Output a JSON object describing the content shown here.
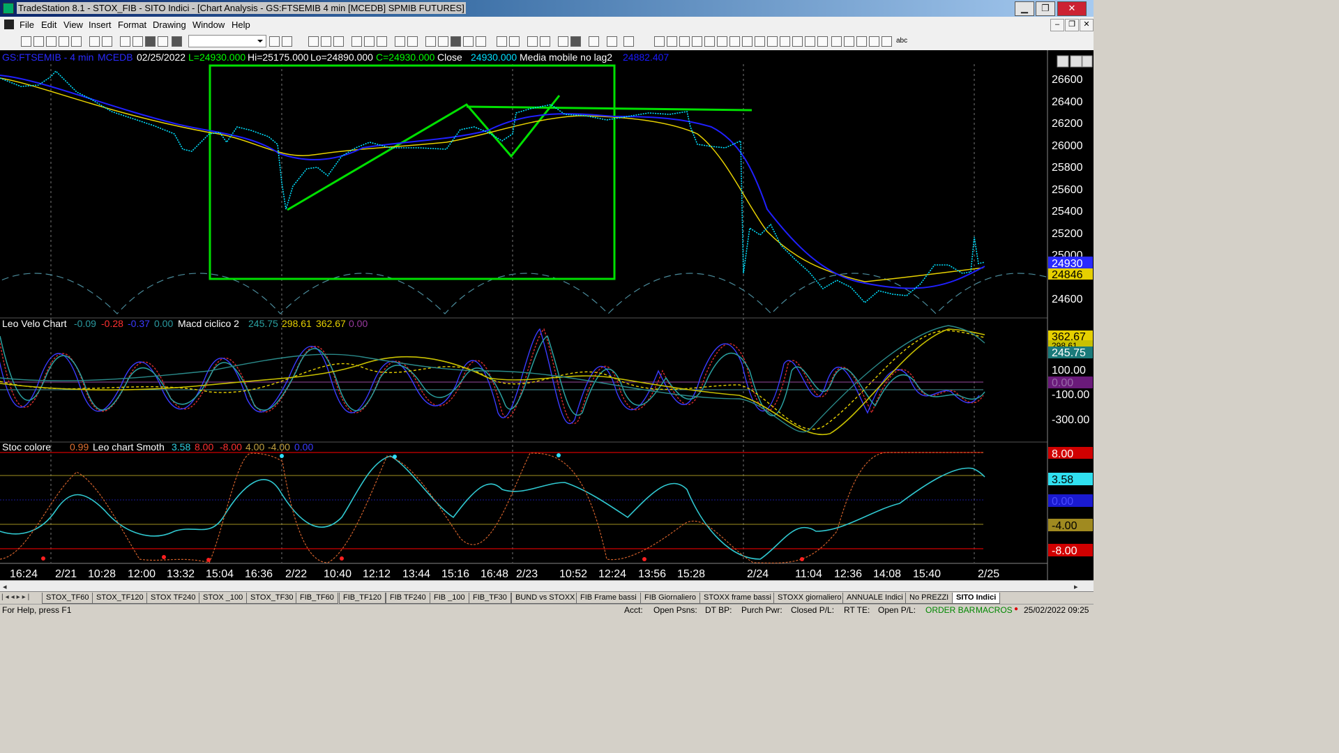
{
  "window": {
    "title": "TradeStation 8.1 - STOX_FIB - SITO Indici - [Chart Analysis - GS:FTSEMIB  4 min  [MCEDB] SPMIB FUTURES]",
    "buttons": {
      "minimize": "▁",
      "maximize": "❐",
      "close": "✕"
    }
  },
  "menu": [
    "File",
    "Edit",
    "View",
    "Insert",
    "Format",
    "Drawing",
    "Window",
    "Help"
  ],
  "mdi_buttons": {
    "minimize": "‒",
    "restore": "❐",
    "close": "✕"
  },
  "toolbar": {
    "symbol_value": "",
    "text_tool": "abc"
  },
  "header": {
    "symbol": "GS:FTSEMIB - 4 min",
    "exchange": "MCEDB",
    "date": "02/25/2022",
    "low_open": "L=24930.000",
    "high": "Hi=25175.000",
    "low": "Lo=24890.000",
    "close_val": "C=24930.000",
    "close_label": "Close",
    "close_num": "24930.000",
    "ma_label": "Media mobile no lag2",
    "ma_value": "24882.407",
    "colors": {
      "green": "#00ff00",
      "white": "#ffffff",
      "blue": "#2a2aff",
      "ma": "#1a1aff"
    }
  },
  "price_axis": {
    "ticks": [
      "26600",
      "26400",
      "26200",
      "26000",
      "25800",
      "25600",
      "25400",
      "25200",
      "25000",
      "24600"
    ],
    "last_price": "24930",
    "ma_price": "24846"
  },
  "indicator1": {
    "name": "Leo Velo Chart",
    "v1": "-0.09",
    "v2": "-0.28",
    "v3": "-0.37",
    "v4": "0.00",
    "name2": "Macd ciclico 2",
    "m1": "245.75",
    "m2": "298.61",
    "m3": "362.67",
    "m4": "0.00",
    "axis": [
      "100.00",
      "-100.00",
      "-300.00"
    ],
    "badges": [
      "362.67",
      "298.61",
      "245.75",
      "0.00"
    ]
  },
  "indicator2": {
    "name": "Stoc colore",
    "s1": "0.99",
    "name2": "Leo chart Smoth",
    "l1": "3.58",
    "l2": "8.00",
    "l3": "-8.00",
    "l4": "4.00",
    "l5": "-4.00",
    "l6": "0.00",
    "badges": [
      "8.00",
      "3.58",
      "0.00",
      "-4.00",
      "-8.00"
    ]
  },
  "time_axis": [
    "16:24",
    "2/21",
    "10:28",
    "12:00",
    "13:32",
    "15:04",
    "16:36",
    "2/22",
    "10:40",
    "12:12",
    "13:44",
    "15:16",
    "16:48",
    "2/23",
    "10:52",
    "12:24",
    "13:56",
    "15:28",
    "2/24",
    "11:04",
    "12:36",
    "14:08",
    "15:40",
    "2/25"
  ],
  "tabs": [
    "STOX_TF60",
    "STOX_TF120",
    "STOX TF240",
    "STOX _100",
    "STOX_TF30",
    "FIB_TF60",
    "FIB_TF120",
    "FIB TF240",
    "FIB _100",
    "FIB_TF30",
    "BUND vs STOXX",
    "FIB Frame bassi",
    "FIB Giornaliero",
    "STOXX frame bassi",
    "STOXX giornaliero",
    "ANNUALE Indici",
    "No PREZZI",
    "SITO Indici"
  ],
  "active_tab": "SITO Indici",
  "status": {
    "help": "For Help, press F1",
    "acct": "Acct:",
    "open_psns": "Open Psns:",
    "dt_bp": "DT BP:",
    "purch_pwr": "Purch Pwr:",
    "closed_pl": "Closed P/L:",
    "rt_te": "RT TE:",
    "open_pl": "Open P/L:",
    "order_bar": "ORDER BAR",
    "macros": "MACROS",
    "datetime": "25/02/2022 09:25"
  },
  "chart_data": {
    "type": "line",
    "title": "GS:FTSEMIB - 4 min",
    "x": [
      "16:24",
      "2/21",
      "10:28",
      "12:00",
      "13:32",
      "15:04",
      "16:36",
      "2/22",
      "10:40",
      "12:12",
      "13:44",
      "15:16",
      "16:48",
      "2/23",
      "10:52",
      "12:24",
      "13:56",
      "15:28",
      "2/24",
      "11:04",
      "12:36",
      "14:08",
      "15:40",
      "2/25"
    ],
    "ylim": [
      24450,
      26750
    ],
    "series": [
      {
        "name": "Close",
        "values": [
          26550,
          26480,
          26360,
          26250,
          26150,
          26080,
          26000,
          25500,
          25800,
          26000,
          26000,
          26050,
          26150,
          26200,
          26300,
          26250,
          26300,
          26250,
          26000,
          25150,
          24850,
          24700,
          24800,
          24930
        ]
      },
      {
        "name": "Media mobile no lag2",
        "values": [
          26600,
          26500,
          26400,
          26300,
          26200,
          26100,
          26060,
          25850,
          25850,
          25950,
          26050,
          26150,
          26100,
          26200,
          26250,
          26270,
          26300,
          26200,
          25900,
          25400,
          24900,
          24680,
          24760,
          24882
        ]
      }
    ],
    "grid": false,
    "legend": "top-left"
  }
}
